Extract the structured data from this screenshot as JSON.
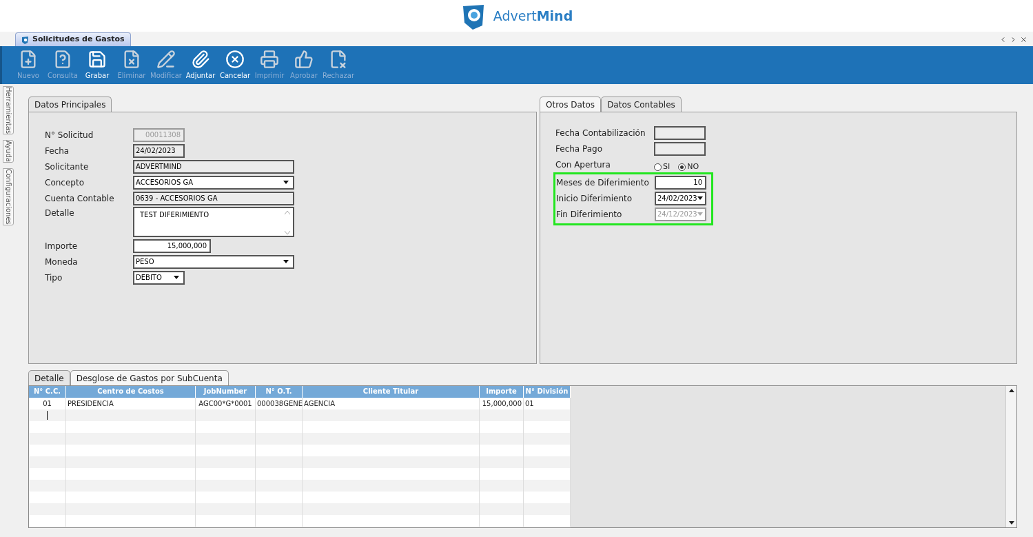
{
  "header": {
    "logo_light": "Advert",
    "logo_bold": "Mind"
  },
  "document_tab": {
    "title": "Solicitudes de Gastos"
  },
  "toolbar": [
    {
      "label": "Nuevo",
      "disabled": true
    },
    {
      "label": "Consulta",
      "disabled": true
    },
    {
      "label": "Grabar",
      "disabled": false
    },
    {
      "label": "Eliminar",
      "disabled": true
    },
    {
      "label": "Modificar",
      "disabled": true
    },
    {
      "label": "Adjuntar",
      "disabled": false
    },
    {
      "label": "Cancelar",
      "disabled": false
    },
    {
      "label": "Imprimir",
      "disabled": true
    },
    {
      "label": "Aprobar",
      "disabled": true
    },
    {
      "label": "Rechazar",
      "disabled": true
    }
  ],
  "side_tabs": [
    "Herramientas",
    "Ayuda",
    "Configuraciones"
  ],
  "main_panel": {
    "tabs": [
      {
        "label": "Datos Principales",
        "selected": true
      }
    ],
    "fields": [
      {
        "label": "N° Solicitud",
        "kind": "text",
        "value": "00011308",
        "readonly": true,
        "disabled": true
      },
      {
        "label": "Fecha",
        "kind": "text",
        "value": "24/02/2023",
        "readonly": true,
        "disabled": false
      },
      {
        "label": "Solicitante",
        "kind": "text",
        "value": "ADVERTMIND",
        "readonly": true,
        "disabled": false
      },
      {
        "label": "Concepto",
        "kind": "select",
        "value": "ACCESORIOS GA",
        "readonly": false,
        "disabled": false
      },
      {
        "label": "Cuenta Contable",
        "kind": "text",
        "value": "0639 - ACCESORIOS GA",
        "readonly": true,
        "disabled": false
      },
      {
        "label": "Detalle",
        "kind": "textarea",
        "value": "TEST DIFERIMIENTO",
        "readonly": false,
        "disabled": false
      },
      {
        "label": "Importe",
        "kind": "number",
        "value": "15,000,000",
        "readonly": false,
        "disabled": false
      },
      {
        "label": "Moneda",
        "kind": "select",
        "value": "PESO",
        "readonly": false,
        "disabled": false
      },
      {
        "label": "Tipo",
        "kind": "select",
        "value": "DEBITO",
        "readonly": false,
        "disabled": false
      }
    ]
  },
  "side_panel": {
    "tabs": [
      {
        "label": "Otros Datos",
        "selected": false
      },
      {
        "label": "Datos Contables",
        "selected": true
      }
    ],
    "fields": [
      {
        "label": "Fecha Contabilización",
        "kind": "text",
        "readonly": true,
        "disabled": false
      },
      {
        "label": "Fecha Pago",
        "kind": "text",
        "readonly": true,
        "disabled": false
      },
      {
        "label": "Con Apertura",
        "kind": "radio",
        "options": [
          {
            "label": "SI",
            "selected": false
          },
          {
            "label": "NO",
            "selected": true
          }
        ]
      }
    ],
    "highlight_group": {
      "fields": [
        {
          "label": "Meses de Diferimiento",
          "kind": "number",
          "value": "10",
          "readonly": false,
          "disabled": false
        },
        {
          "label": "Inicio Diferimiento",
          "kind": "date-select",
          "value": "24/02/2023",
          "readonly": false,
          "disabled": false
        },
        {
          "label": "Fin Diferimiento",
          "kind": "date-select",
          "value": "24/12/2023",
          "readonly": false,
          "disabled": true
        }
      ]
    }
  },
  "detail": {
    "tabs": [
      {
        "label": "Detalle",
        "selected": true
      },
      {
        "label": "Desglose de Gastos por SubCuenta",
        "selected": false
      }
    ],
    "columns": [
      "N° C.C.",
      "Centro de Costos",
      "JobNumber",
      "N° O.T.",
      "Cliente Titular",
      "Importe",
      "N° División"
    ],
    "rows": [
      [
        "01",
        "PRESIDENCIA",
        "AGC00*G*0001",
        "000038GENE",
        "AGENCIA",
        "15,000,000",
        "01"
      ]
    ]
  }
}
